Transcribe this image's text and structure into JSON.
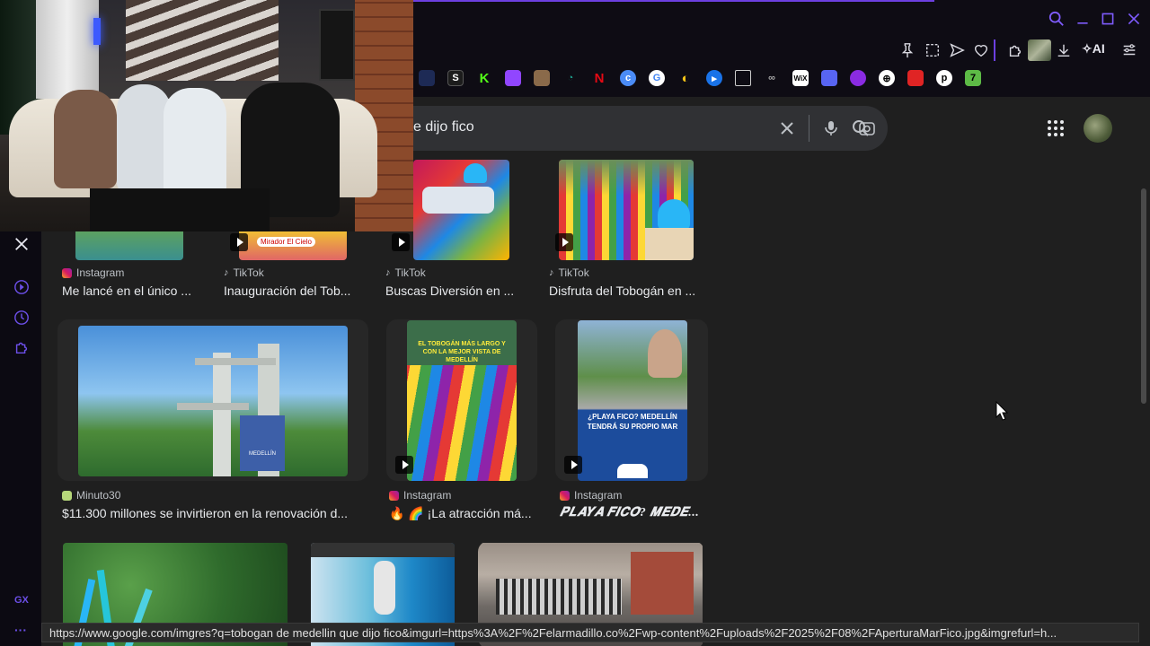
{
  "search": {
    "query": "e dijo fico"
  },
  "toolbar": {
    "ai_label": "AI"
  },
  "sidebar": {
    "gx_label": "GX",
    "more_label": "···"
  },
  "results": [
    {
      "source": "Instagram",
      "title": "Me lancé en el único ..."
    },
    {
      "source": "TikTok",
      "title": "Inauguración del Tob..."
    },
    {
      "source": "TikTok",
      "title": "Buscas Diversión en ..."
    },
    {
      "source": "TikTok",
      "title": "Disfruta del Tobogán en ..."
    },
    {
      "source": "Minuto30",
      "title": "$11.300 millones se invirtieron en la renovación d..."
    },
    {
      "source": "Instagram",
      "title": "🔥 🌈 ¡La atracción má..."
    },
    {
      "source": "Instagram",
      "title": "𝑷𝑳𝑨𝒀𝑨 𝑭𝑰𝑪𝑶? 𝑴𝑬𝑫𝑬..."
    }
  ],
  "thumb_texts": {
    "mirador": "Mirador El Cielo",
    "tobogan": "EL TOBOGÁN MÁS LARGO Y CON LA MEJOR VISTA DE MEDELLÍN",
    "playa": "¿PLAYA FICO? MEDELLÍN TENDRÁ SU PROPIO MAR",
    "medellin": "MEDELLÍN"
  },
  "status": {
    "url": "https://www.google.com/imgres?q=tobogan de medellin que dijo fico&imgurl=https%3A%2F%2Felarmadillo.co%2Fwp-content%2Fuploads%2F2025%2F08%2FAperturaMarFico.jpg&imgrefurl=h..."
  },
  "colors": {
    "accent": "#6c3fe0",
    "page_bg": "#1f1f1f",
    "search_bg": "#303134"
  }
}
